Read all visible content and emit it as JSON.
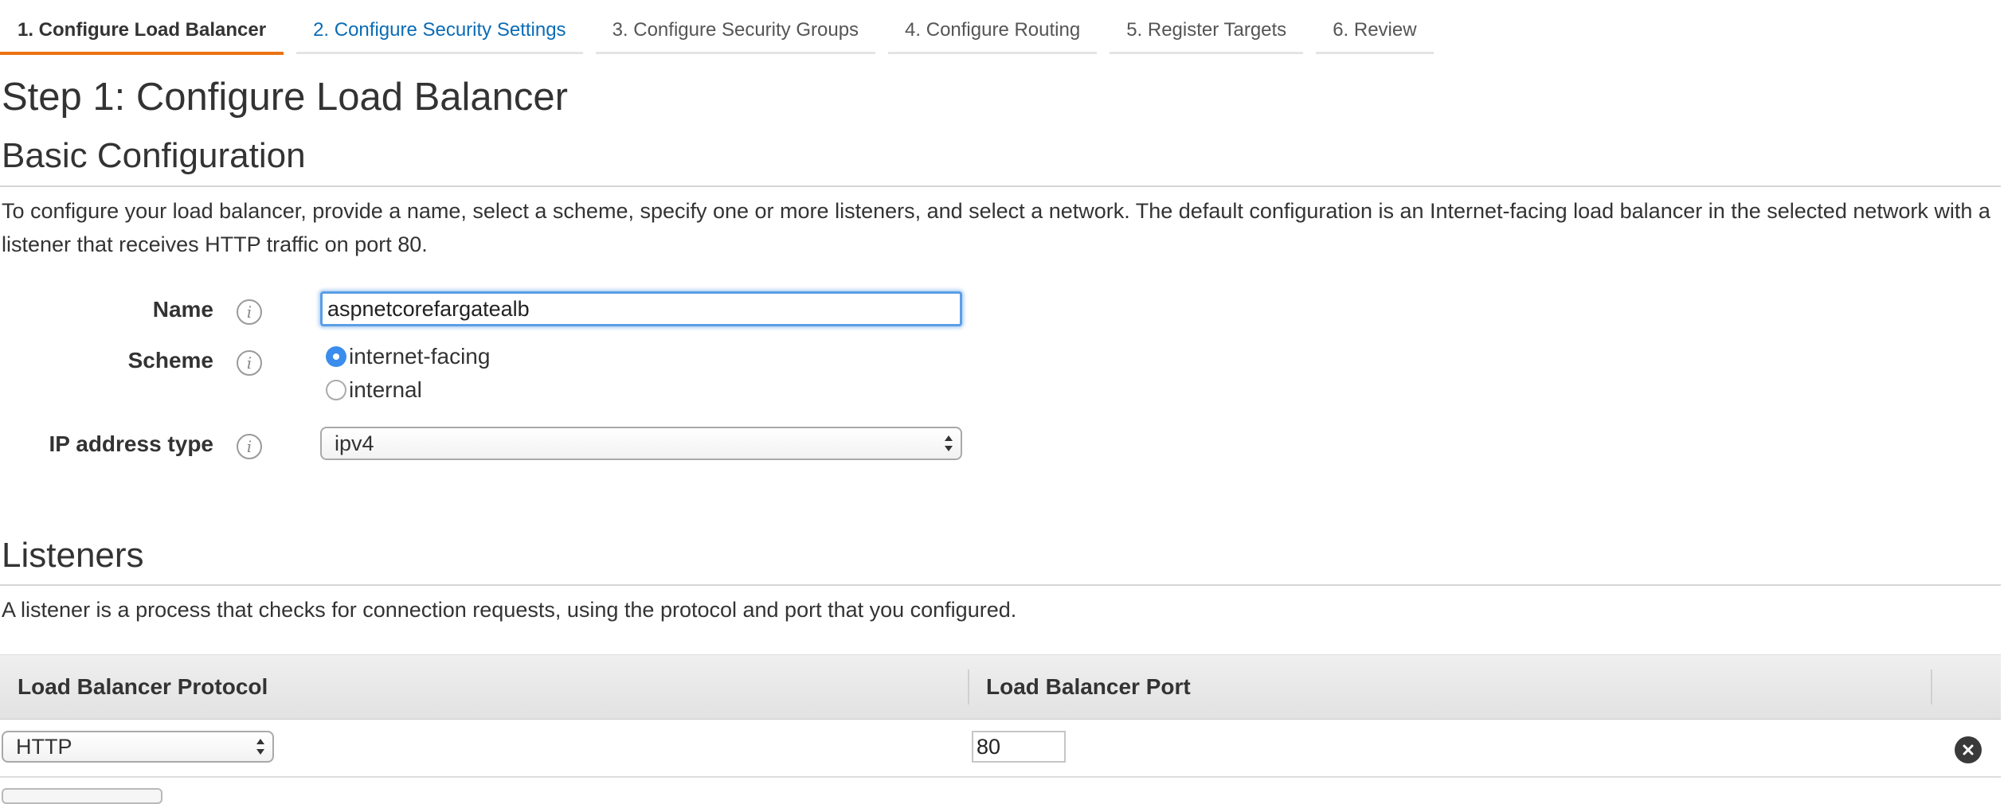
{
  "tabs": [
    {
      "label": "1. Configure Load Balancer",
      "state": "active"
    },
    {
      "label": "2. Configure Security Settings",
      "state": "link"
    },
    {
      "label": "3. Configure Security Groups",
      "state": "default"
    },
    {
      "label": "4. Configure Routing",
      "state": "default"
    },
    {
      "label": "5. Register Targets",
      "state": "default"
    },
    {
      "label": "6. Review",
      "state": "default"
    }
  ],
  "page_title": "Step 1: Configure Load Balancer",
  "basic": {
    "heading": "Basic Configuration",
    "description": "To configure your load balancer, provide a name, select a scheme, specify one or more listeners, and select a network. The default configuration is an Internet-facing load balancer in the selected network with a listener that receives HTTP traffic on port 80.",
    "name_label": "Name",
    "name_value": "aspnetcorefargatealb",
    "scheme_label": "Scheme",
    "scheme_options": [
      "internet-facing",
      "internal"
    ],
    "scheme_selected": "internet-facing",
    "ip_label": "IP address type",
    "ip_value": "ipv4"
  },
  "listeners": {
    "heading": "Listeners",
    "description": "A listener is a process that checks for connection requests, using the protocol and port that you configured.",
    "columns": [
      "Load Balancer Protocol",
      "Load Balancer Port"
    ],
    "rows": [
      {
        "protocol": "HTTP",
        "port": "80"
      }
    ]
  },
  "icons": {
    "info": "info-icon",
    "remove": "close-circle-icon",
    "select": "select-arrows-icon"
  },
  "colors": {
    "active_tab_underline": "#ec7211",
    "link": "#0a6cb6",
    "focus": "#5b9ee6",
    "radio_checked": "#3b8ded"
  }
}
